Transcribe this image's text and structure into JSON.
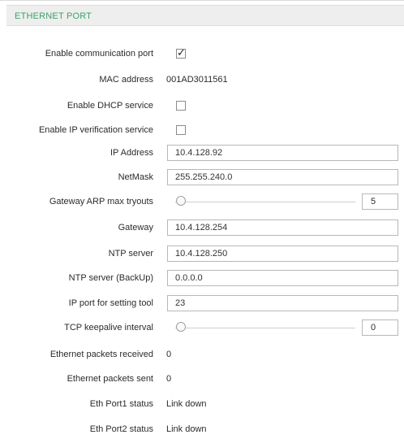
{
  "panel": {
    "title": "ETHERNET PORT"
  },
  "fields": {
    "enable_port": {
      "label": "Enable communication port",
      "checked": true
    },
    "mac": {
      "label": "MAC address",
      "value": "001AD3011561"
    },
    "dhcp": {
      "label": "Enable DHCP service",
      "checked": false
    },
    "ip_verify": {
      "label": "Enable IP verification service",
      "checked": false
    },
    "ip_address": {
      "label": "IP Address",
      "value": "10.4.128.92"
    },
    "netmask": {
      "label": "NetMask",
      "value": "255.255.240.0"
    },
    "arp_tryouts": {
      "label": "Gateway ARP max tryouts",
      "value": "5"
    },
    "gateway": {
      "label": "Gateway",
      "value": "10.4.128.254"
    },
    "ntp": {
      "label": "NTP server",
      "value": "10.4.128.250"
    },
    "ntp_backup": {
      "label": "NTP server (BackUp)",
      "value": "0.0.0.0"
    },
    "ip_port_tool": {
      "label": "IP port for setting tool",
      "value": "23"
    },
    "keepalive": {
      "label": "TCP keepalive interval",
      "value": "0"
    },
    "packets_received": {
      "label": "Ethernet packets received",
      "value": "0"
    },
    "packets_sent": {
      "label": "Ethernet packets sent",
      "value": "0"
    },
    "port1_status": {
      "label": "Eth Port1 status",
      "value": "Link down"
    },
    "port2_status": {
      "label": "Eth Port2 status",
      "value": "Link down"
    }
  },
  "icons": {
    "check": "checkmark-icon"
  },
  "colors": {
    "header_text": "#3aa36a",
    "header_bg": "#eeeeee"
  }
}
